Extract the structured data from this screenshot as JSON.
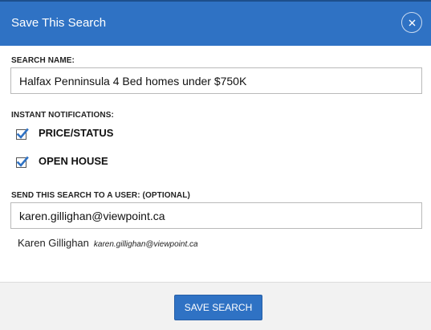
{
  "header": {
    "title": "Save This Search",
    "close_icon": "close-icon"
  },
  "search_name": {
    "label": "SEARCH NAME:",
    "value": "Halfax Penninsula 4 Bed homes under $750K"
  },
  "notifications": {
    "label": "INSTANT NOTIFICATIONS:",
    "options": [
      {
        "label": "PRICE/STATUS",
        "checked": true
      },
      {
        "label": "OPEN HOUSE",
        "checked": true
      }
    ]
  },
  "send_to_user": {
    "label": "SEND THIS SEARCH TO A USER: (OPTIONAL)",
    "value": "karen.gillighan@viewpoint.ca",
    "suggestion": {
      "name": "Karen Gillighan",
      "email": "karen.gillighan@viewpoint.ca"
    }
  },
  "footer": {
    "save_label": "SAVE SEARCH"
  },
  "colors": {
    "accent": "#2f72c4",
    "checkmark": "#2f72c4"
  }
}
